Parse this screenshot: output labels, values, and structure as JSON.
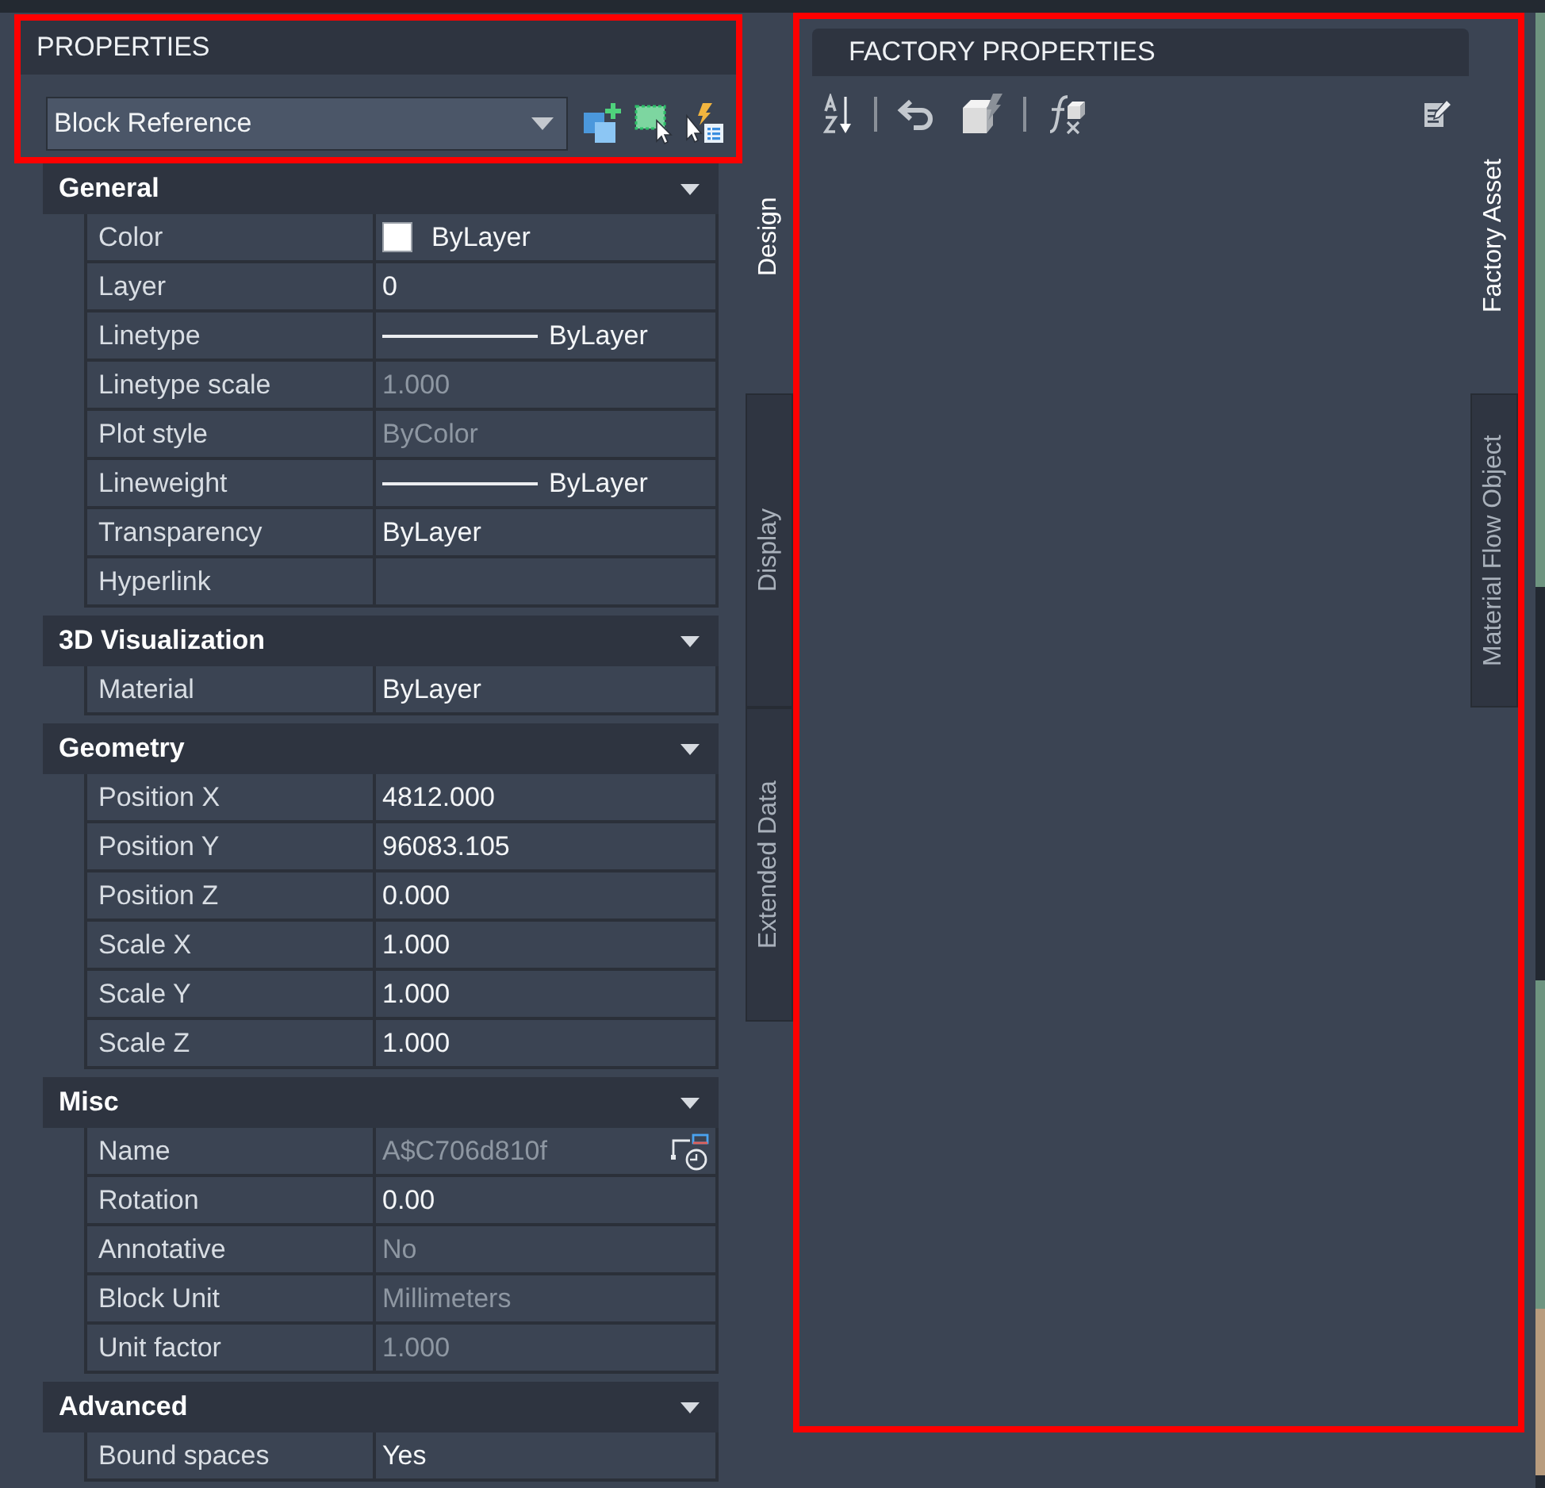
{
  "properties_panel": {
    "title": "PROPERTIES",
    "highlighted": true,
    "object_type": "Block Reference",
    "sections": [
      {
        "title": "General",
        "expanded": true,
        "rows": [
          {
            "label": "Color",
            "kind": "swatch",
            "color": "#ffffff",
            "value": "ByLayer",
            "disabled": false
          },
          {
            "label": "Layer",
            "kind": "text",
            "value": "0",
            "disabled": false
          },
          {
            "label": "Linetype",
            "kind": "line",
            "value": "ByLayer",
            "disabled": false
          },
          {
            "label": "Linetype scale",
            "kind": "text",
            "value": "1.000",
            "disabled": true
          },
          {
            "label": "Plot style",
            "kind": "text",
            "value": "ByColor",
            "disabled": true
          },
          {
            "label": "Lineweight",
            "kind": "line",
            "value": "ByLayer",
            "disabled": false
          },
          {
            "label": "Transparency",
            "kind": "text",
            "value": "ByLayer",
            "disabled": false
          },
          {
            "label": "Hyperlink",
            "kind": "text",
            "disabled": false
          }
        ]
      },
      {
        "title": "3D Visualization",
        "expanded": true,
        "rows": [
          {
            "label": "Material",
            "kind": "text",
            "value": "ByLayer",
            "disabled": false
          }
        ]
      },
      {
        "title": "Geometry",
        "expanded": true,
        "rows": [
          {
            "label": "Position X",
            "kind": "text",
            "value": "4812.000",
            "disabled": false
          },
          {
            "label": "Position Y",
            "kind": "text",
            "value": "96083.105",
            "disabled": false
          },
          {
            "label": "Position Z",
            "kind": "text",
            "value": "0.000",
            "disabled": false
          },
          {
            "label": "Scale X",
            "kind": "text",
            "value": "1.000",
            "disabled": false
          },
          {
            "label": "Scale Y",
            "kind": "text",
            "value": "1.000",
            "disabled": false
          },
          {
            "label": "Scale Z",
            "kind": "text",
            "value": "1.000",
            "disabled": false
          }
        ]
      },
      {
        "title": "Misc",
        "expanded": true,
        "rows": [
          {
            "label": "Name",
            "kind": "picker",
            "value": "A$C706d810f",
            "disabled": true
          },
          {
            "label": "Rotation",
            "kind": "text",
            "value": "0.00",
            "disabled": false
          },
          {
            "label": "Annotative",
            "kind": "text",
            "value": "No",
            "disabled": true
          },
          {
            "label": "Block Unit",
            "kind": "text",
            "value": "Millimeters",
            "disabled": true
          },
          {
            "label": "Unit factor",
            "kind": "text",
            "value": "1.000",
            "disabled": true
          }
        ]
      },
      {
        "title": "Advanced",
        "expanded": true,
        "rows": [
          {
            "label": "Bound spaces",
            "kind": "text",
            "value": "Yes",
            "disabled": false
          }
        ]
      }
    ]
  },
  "side_tabs": [
    {
      "label": "Design",
      "selected": true
    },
    {
      "label": "Display",
      "selected": false
    },
    {
      "label": "Extended Data",
      "selected": false
    }
  ],
  "factory_panel": {
    "title": "FACTORY PROPERTIES",
    "highlighted": true
  },
  "factory_tabs": [
    {
      "label": "Factory Asset",
      "selected": true
    },
    {
      "label": "Material Flow Object",
      "selected": false
    }
  ]
}
